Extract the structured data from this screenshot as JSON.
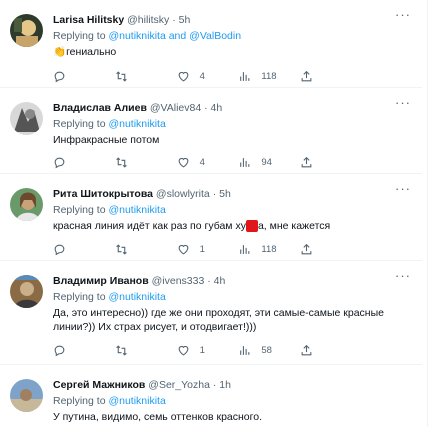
{
  "tweets": [
    {
      "name": "Larisa Hilitsky",
      "handle": "@hilitsky",
      "time": "· 5h",
      "replying_prefix": "Replying to",
      "replying_to": "@nutiknikita and @ValBodin",
      "emoji": "👏",
      "text": "гениально",
      "replies": "",
      "retweets": "",
      "likes": "4",
      "views": "118",
      "avatar_colors": [
        "#2e3a2c",
        "#e6c78a"
      ]
    },
    {
      "name": "Владислав Алиев",
      "handle": "@VAliev84",
      "time": "· 4h",
      "replying_prefix": "Replying to",
      "replying_to": "@nutiknikita",
      "text": "Инфракрасные потом",
      "replies": "",
      "retweets": "",
      "likes": "4",
      "views": "94",
      "avatar_colors": [
        "#d8d8d8",
        "#555555"
      ]
    },
    {
      "name": "Рита Шитокрытова",
      "handle": "@slowlyrita",
      "time": "· 5h",
      "replying_prefix": "Replying to",
      "replying_to": "@nutiknikita",
      "text": "красная линия идёт как раз по губам ху",
      "text_strike": "йл",
      "text_end": "а, мне кажется",
      "replies": "",
      "retweets": "",
      "likes": "1",
      "views": "118",
      "avatar_colors": [
        "#6a9a6a",
        "#caa27a"
      ]
    },
    {
      "name": "Владимир Иванов",
      "handle": "@ivens333",
      "time": "· 4h",
      "replying_prefix": "Replying to",
      "replying_to": "@nutiknikita",
      "text": "Да, это интересно)) где же они проходят, эти самые-самые красные линии?)) Их страх рисует, и отодвигает!)))",
      "replies": "",
      "retweets": "",
      "likes": "1",
      "views": "58",
      "avatar_colors": [
        "#8a6b45",
        "#c9b08a"
      ]
    },
    {
      "name": "Сергей Мажников",
      "handle": "@Ser_Yozha",
      "time": "· 1h",
      "replying_prefix": "Replying to",
      "replying_to": "@nutiknikita",
      "text": "У путина, видимо, семь оттенков красного.",
      "avatar_colors": [
        "#7fa3c8",
        "#c8b89a"
      ]
    }
  ],
  "icons": {
    "reply": "reply-icon",
    "retweet": "retweet-icon",
    "like": "heart-icon",
    "views": "views-icon",
    "share": "share-icon",
    "more": "more-icon"
  },
  "colors": {
    "accent": "#1d9bf0",
    "secondary_text": "#536471",
    "primary_text": "#0f1419",
    "divider": "#eff3f4",
    "redaction": "#e0161b"
  }
}
